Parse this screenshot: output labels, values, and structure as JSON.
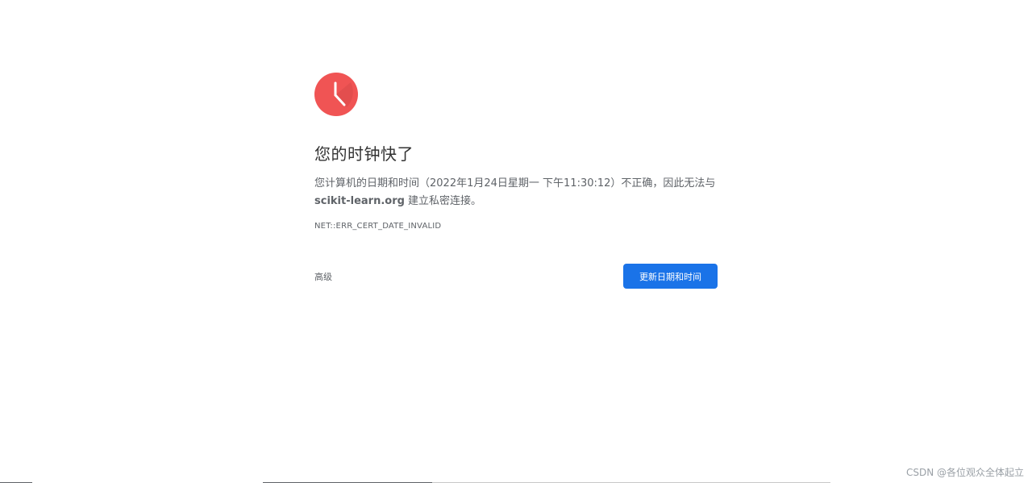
{
  "error_page": {
    "title": "您的时钟快了",
    "explanation_prefix": "您计算机的日期和时间（2022年1月24日星期一 下午11:30:12）不正确，因此无法与 ",
    "site": "scikit-learn.org",
    "explanation_suffix": " 建立私密连接。",
    "error_code": "NET::ERR_CERT_DATE_INVALID",
    "advanced_label": "高级",
    "primary_button_label": "更新日期和时间"
  },
  "icon": {
    "name": "clock-icon",
    "color": "#f05454"
  },
  "watermark": "CSDN @各位观众全体起立",
  "colors": {
    "primary_button": "#1a73e8",
    "title_text": "#333333",
    "body_text": "#5f6368"
  }
}
